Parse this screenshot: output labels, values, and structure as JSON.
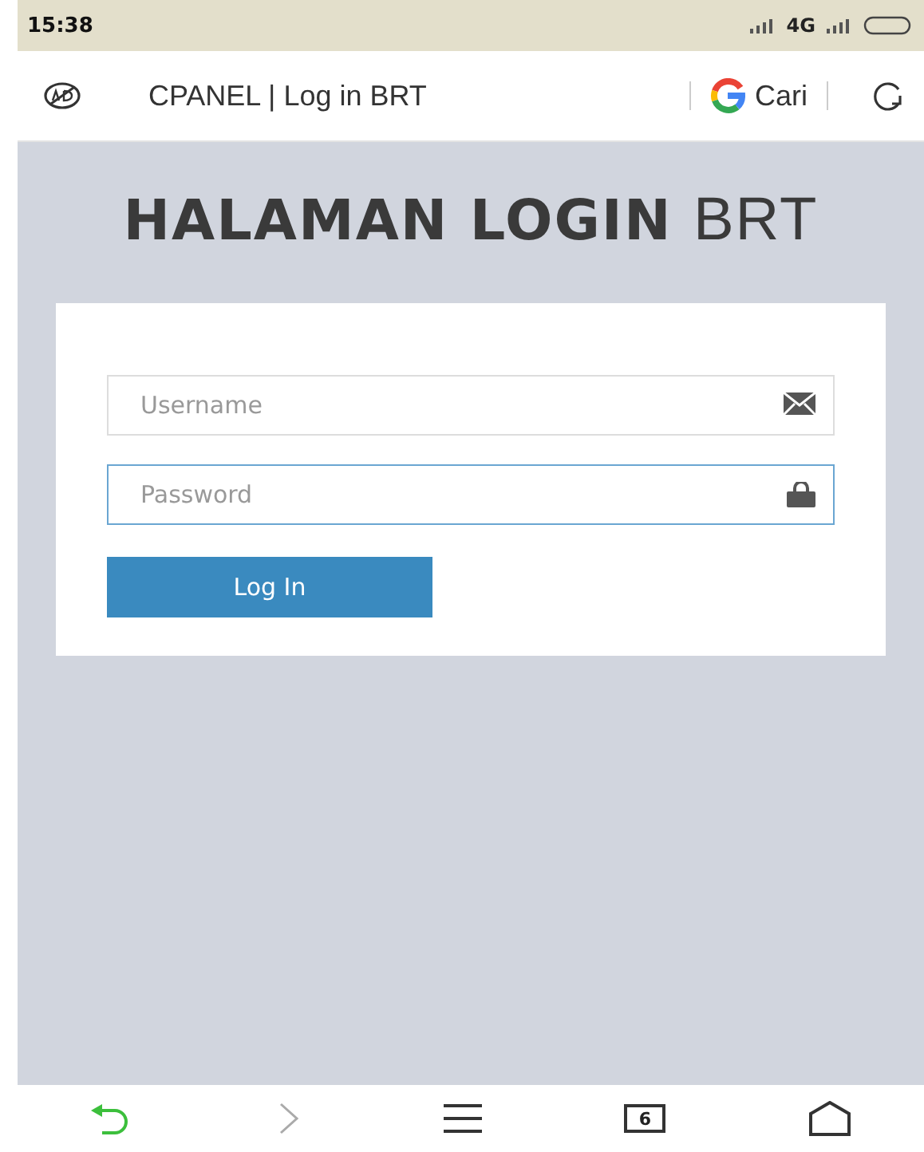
{
  "status_bar": {
    "time": "15:38",
    "network": "4G"
  },
  "address_bar": {
    "title": "CPANEL | Log in BRT",
    "search_label": "Cari"
  },
  "heading": {
    "bold": "HALAMAN LOGIN",
    "light": "BRT"
  },
  "fields": [
    {
      "placeholder": "Username",
      "kind": "mail",
      "focused": false
    },
    {
      "placeholder": "Password",
      "kind": "lock",
      "focused": true
    }
  ],
  "login_button": "Log In",
  "nav_bar": {
    "tab_count": "6"
  }
}
